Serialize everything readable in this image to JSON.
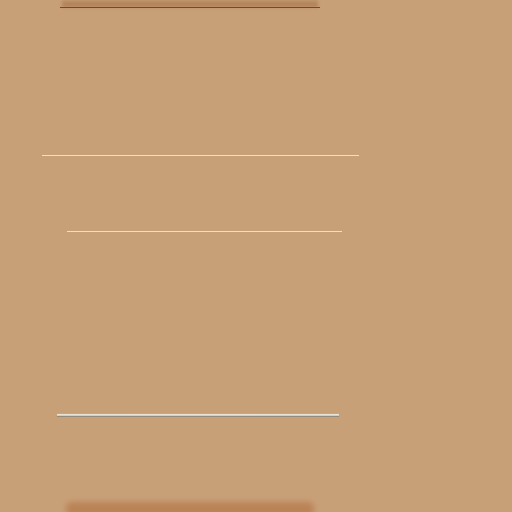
{
  "screen": {
    "background_color": "#c8a078",
    "rule_color": "#f1dcc4",
    "separators": [
      {
        "name": "top-edge"
      },
      {
        "name": "separator-rule-1"
      },
      {
        "name": "separator-rule-2"
      },
      {
        "name": "metal-rule"
      },
      {
        "name": "bottom-shadow"
      }
    ]
  }
}
